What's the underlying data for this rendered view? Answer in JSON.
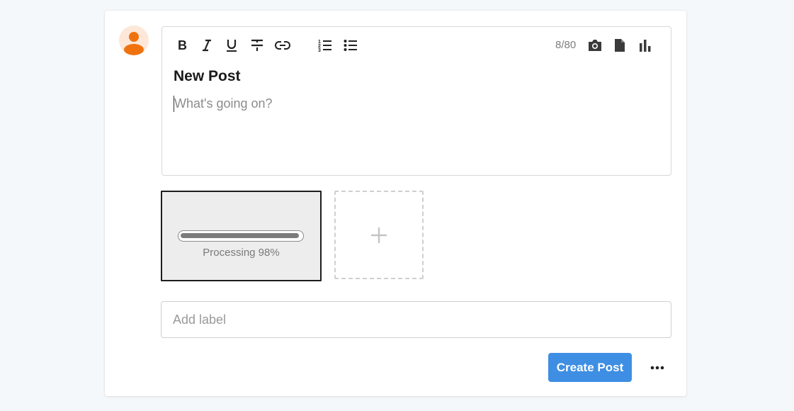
{
  "editor": {
    "title": "New Post",
    "body_placeholder": "What's going on?",
    "char_counter": "8/80",
    "toolbar": {
      "format_icons": [
        "bold-icon",
        "italic-icon",
        "underline-icon",
        "strikethrough-icon",
        "link-icon"
      ],
      "list_icons": [
        "ordered-list-icon",
        "bullet-list-icon"
      ],
      "attach_icons": [
        "camera-icon",
        "file-icon",
        "poll-chart-icon"
      ]
    }
  },
  "upload": {
    "status_text": "Processing 98%",
    "progress": 0.98,
    "add_icon": "plus-icon"
  },
  "label_field": {
    "placeholder": "Add label",
    "value": ""
  },
  "actions": {
    "create_label": "Create Post",
    "more_icon": "more-horizontal-icon"
  },
  "colors": {
    "accent": "#3e8ee3",
    "avatar_fg": "#f0720f",
    "avatar_bg": "#fde7d8"
  }
}
